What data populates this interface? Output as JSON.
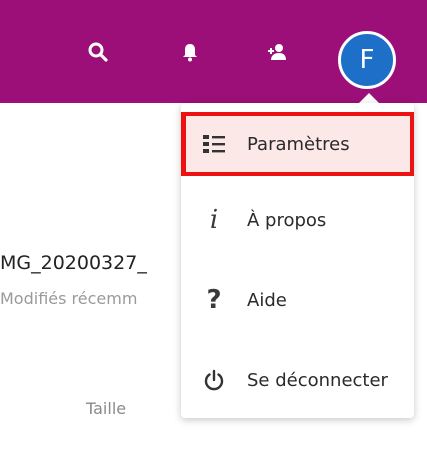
{
  "header": {
    "avatar_initial": "F",
    "bar_color": "#9c0f78",
    "avatar_color": "#1d6fc8",
    "icons": [
      "search-icon",
      "bell-icon",
      "contacts-icon"
    ]
  },
  "background": {
    "file_name": "MG_20200327_",
    "subtitle": "Modifiés récemm",
    "column_header": "Taille"
  },
  "user_menu": {
    "items": [
      {
        "label": "Paramètres",
        "icon": "settings-list-icon",
        "active": true
      },
      {
        "label": "À propos",
        "icon": "info-icon"
      },
      {
        "label": "Aide",
        "icon": "help-icon"
      },
      {
        "label": "Se déconnecter",
        "icon": "power-icon"
      }
    ],
    "highlight_color": "#ee1111"
  }
}
